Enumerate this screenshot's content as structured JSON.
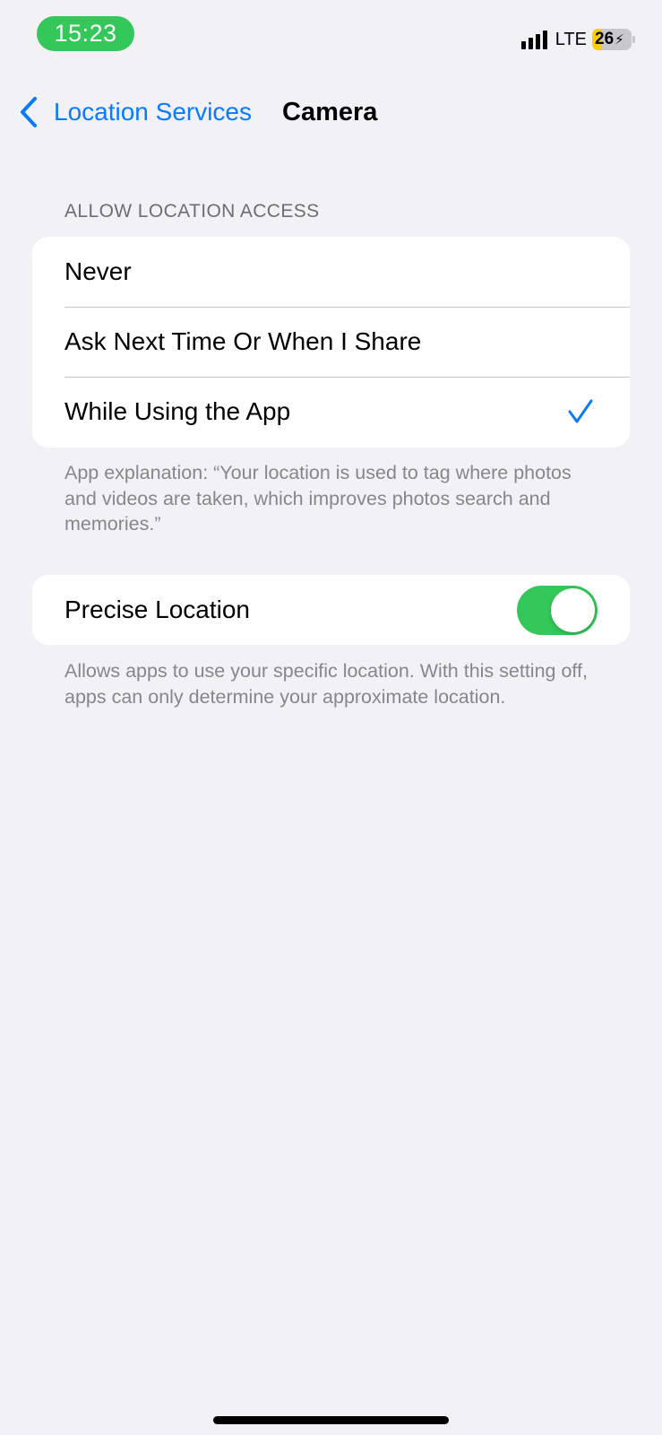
{
  "status_bar": {
    "time": "15:23",
    "network": "LTE",
    "battery_level": "26",
    "battery_fraction": 0.26,
    "battery_color": "#ffcc00",
    "signal_bars": 4
  },
  "nav": {
    "back_label": "Location Services",
    "title": "Camera"
  },
  "access_section": {
    "header": "ALLOW LOCATION ACCESS",
    "options": [
      {
        "label": "Never",
        "selected": false
      },
      {
        "label": "Ask Next Time Or When I Share",
        "selected": false
      },
      {
        "label": "While Using the App",
        "selected": true
      }
    ],
    "footer": "App explanation: “Your location is used to tag where photos and videos are taken, which improves photos search and memories.”"
  },
  "precise_section": {
    "label": "Precise Location",
    "enabled": true,
    "footer": "Allows apps to use your specific location. With this setting off, apps can only determine your approximate location."
  },
  "colors": {
    "accent": "#0a7aff",
    "toggle_on": "#34c759",
    "background": "#f1f1f6"
  }
}
